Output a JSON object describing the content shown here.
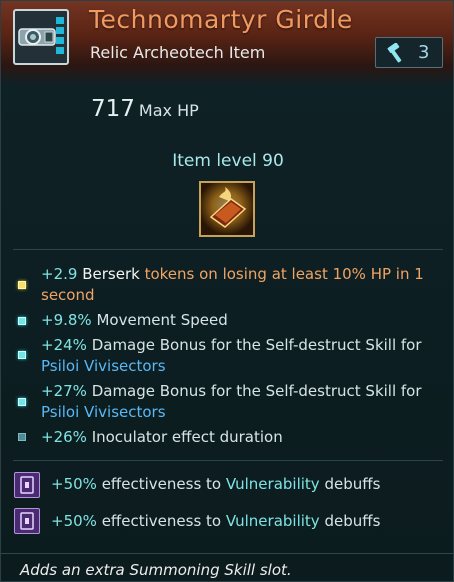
{
  "item": {
    "name": "Technomartyr Girdle",
    "type": "Relic Archeotech Item",
    "salvage_value": "3"
  },
  "stat": {
    "value": "717",
    "label": "Max HP"
  },
  "item_level": "Item level 90",
  "affixes": [
    {
      "value": "+2.9",
      "keyword": "Berserk",
      "rest": "tokens on losing at least 10% HP in 1 second",
      "bullet": "yellow"
    },
    {
      "value": "+9.8%",
      "text": "Movement Speed",
      "bullet": "cyan"
    },
    {
      "value": "+24%",
      "text": "Damage Bonus for the Self-destruct Skill for",
      "link": "Psiloi Vivisectors",
      "bullet": "cyan"
    },
    {
      "value": "+27%",
      "text": "Damage Bonus for the Self-destruct Skill for",
      "link": "Psiloi Vivisectors",
      "bullet": "cyan"
    },
    {
      "value": "+26%",
      "text": "Inoculator effect duration",
      "bullet": "dim"
    }
  ],
  "augments": [
    {
      "value": "+50%",
      "pre": "effectiveness to",
      "keyword": "Vulnerability",
      "post": "debuffs"
    },
    {
      "value": "+50%",
      "pre": "effectiveness to",
      "keyword": "Vulnerability",
      "post": "debuffs"
    }
  ],
  "footer": "Adds an extra Summoning Skill slot.",
  "colors": {
    "title": "#ef9a61",
    "cyan": "#7fe3e3",
    "orange": "#f0a464",
    "link_blue": "#59b8f5",
    "background": "#0c1a1d"
  },
  "icons": {
    "item": "belt-archeotech-icon",
    "salvage": "hammer-icon",
    "relic": "relic-book-icon",
    "augment": "augment-slot-icon"
  }
}
